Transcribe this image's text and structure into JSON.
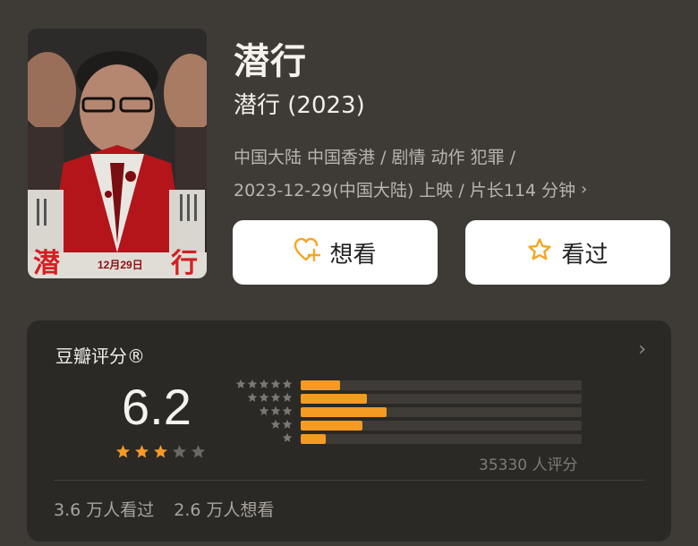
{
  "movie": {
    "title": "潜行",
    "subtitle": "潜行 (2023)",
    "meta_line1": "中国大陆 中国香港 / 剧情 动作 犯罪 /",
    "meta_line2": "2023-12-29(中国大陆) 上映 / 片长114 分钟",
    "chevron": "›"
  },
  "poster": {
    "title_text": "潜 行",
    "date_text": "12月29日"
  },
  "buttons": {
    "want_label": "想看",
    "want_icon": "heart-plus-icon",
    "seen_label": "看过",
    "seen_icon": "star-outline-icon"
  },
  "rating": {
    "header": "豆瓣评分®",
    "header_chevron": "›",
    "score": "6.2",
    "stars": {
      "filled": 3,
      "total": 5
    },
    "distribution": [
      {
        "stars": 5,
        "fraction": 0.14
      },
      {
        "stars": 4,
        "fraction": 0.235
      },
      {
        "stars": 3,
        "fraction": 0.305
      },
      {
        "stars": 2,
        "fraction": 0.22
      },
      {
        "stars": 1,
        "fraction": 0.09
      }
    ],
    "count_text": "35330 人评分"
  },
  "stats": {
    "seen_text": "3.6 万人看过",
    "want_text": "2.6 万人想看"
  },
  "colors": {
    "background": "#3e3b37",
    "card": "#2b2926",
    "accent": "#f59a23",
    "star_gray": "#6b6863"
  }
}
